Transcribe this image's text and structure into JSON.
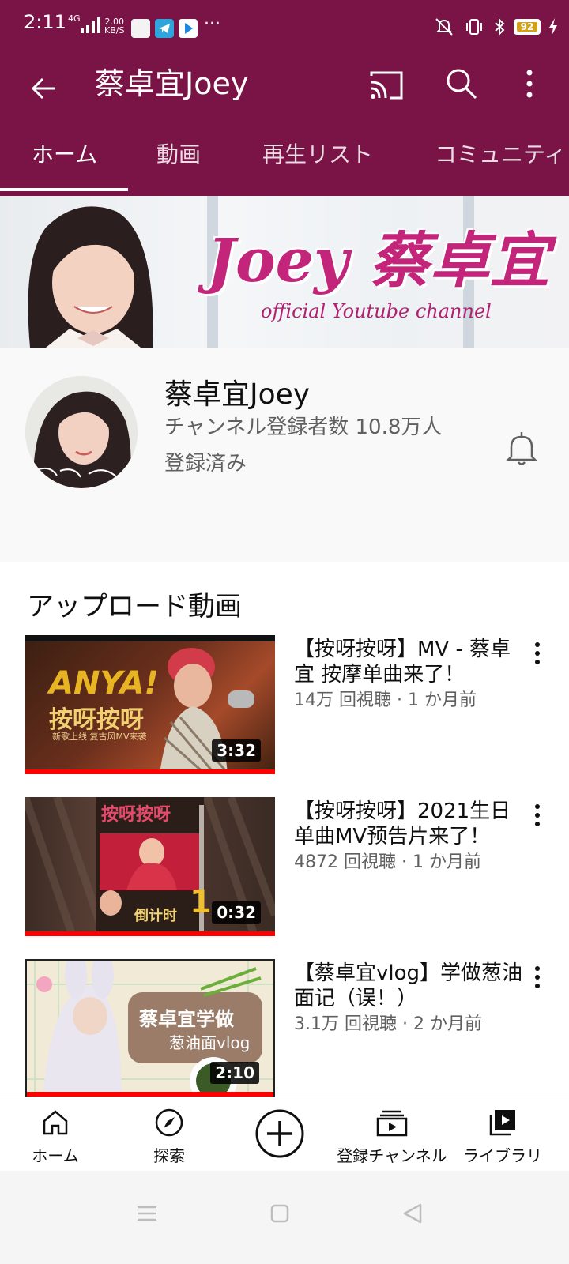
{
  "status_bar": {
    "time": "2:11",
    "network": "4G",
    "speed_value": "2.00",
    "speed_unit": "KB/S",
    "more": "···",
    "battery": "92"
  },
  "app_bar": {
    "title": "蔡卓宜Joey",
    "tabs": [
      {
        "label": "ホーム"
      },
      {
        "label": "動画"
      },
      {
        "label": "再生リスト"
      },
      {
        "label": "コミュニティ"
      }
    ]
  },
  "banner": {
    "title": "Joey 蔡卓宜",
    "subtitle": "official Youtube channel"
  },
  "channel": {
    "name": "蔡卓宜Joey",
    "subscribers": "チャンネル登録者数 10.8万人",
    "status": "登録済み"
  },
  "uploads": {
    "section_title": "アップロード動画",
    "videos": [
      {
        "title": "【按呀按呀】MV - 蔡卓宜 按摩单曲来了！",
        "meta": "14万 回視聴 · 1 か月前",
        "duration": "3:32",
        "thumb_text_1": "ANYA!",
        "thumb_text_2": "按呀按呀",
        "thumb_text_3": "新歌上线 复古风MV来袭"
      },
      {
        "title": "【按呀按呀】2021生日单曲MV预告片来了！",
        "meta": "4872 回視聴 · 1 か月前",
        "duration": "0:32",
        "thumb_text_1": "按呀按呀",
        "thumb_text_2": "倒计时",
        "thumb_text_3": "1"
      },
      {
        "title": "【蔡卓宜vlog】学做葱油面记（误！）",
        "meta": "3.1万 回視聴 · 2 か月前",
        "duration": "2:10",
        "thumb_text_1": "蔡卓宜学做",
        "thumb_text_2": "葱油面vlog"
      }
    ]
  },
  "bottom_nav": {
    "home": "ホーム",
    "explore": "探索",
    "subscriptions": "登録チャンネル",
    "library": "ライブラリ"
  },
  "colors": {
    "brand": "#7a1346",
    "progress": "#ff0000"
  }
}
